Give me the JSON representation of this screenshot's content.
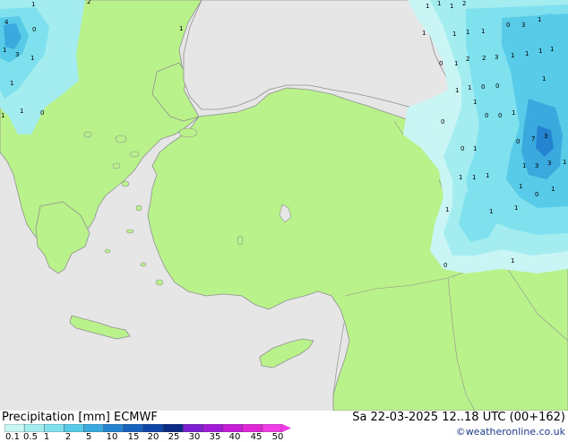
{
  "title": "Precipitation [mm]  ECMWF",
  "datetime": "Sa 22-03-2025 12..18 UTC (00+162)",
  "credit": "©weatheronline.co.uk",
  "colors": {
    "sea": "#e6e6e6",
    "land": "#b9f28a",
    "coast": "#909090",
    "p01": "#c9f5f5",
    "p05": "#a3ecf0",
    "p1": "#7fe0ee",
    "p2": "#58cbe8",
    "p5": "#3aa9de",
    "p10": "#2483d0",
    "p15": "#1761bf",
    "p20": "#0f45a8",
    "p25": "#0a2b86",
    "p30": "#7b1fd0",
    "p35": "#a21cd8",
    "p40": "#c41ed8",
    "p45": "#de28d8",
    "p50": "#f03ce6"
  },
  "legend": {
    "labels": [
      "0.1",
      "0.5",
      "1",
      "2",
      "5",
      "10",
      "15",
      "20",
      "25",
      "30",
      "35",
      "40",
      "45",
      "50"
    ]
  },
  "map_values": [
    "1",
    "2",
    "4",
    "0",
    "3",
    "1",
    "1",
    "1",
    "0",
    "1",
    "1",
    "1",
    "1",
    "1",
    "1",
    "2",
    "1",
    "0",
    "1",
    "1",
    "1",
    "0",
    "3",
    "1",
    "1",
    "2",
    "2",
    "3",
    "1",
    "1",
    "1",
    "1",
    "1",
    "1",
    "0",
    "0",
    "0",
    "0",
    "1",
    "1",
    "1",
    "1",
    "0",
    "7",
    "3",
    "1",
    "3",
    "3",
    "1",
    "1",
    "0",
    "0",
    "1",
    "1",
    "0",
    "1",
    "1",
    "1",
    "1",
    "0",
    "1",
    "1"
  ]
}
